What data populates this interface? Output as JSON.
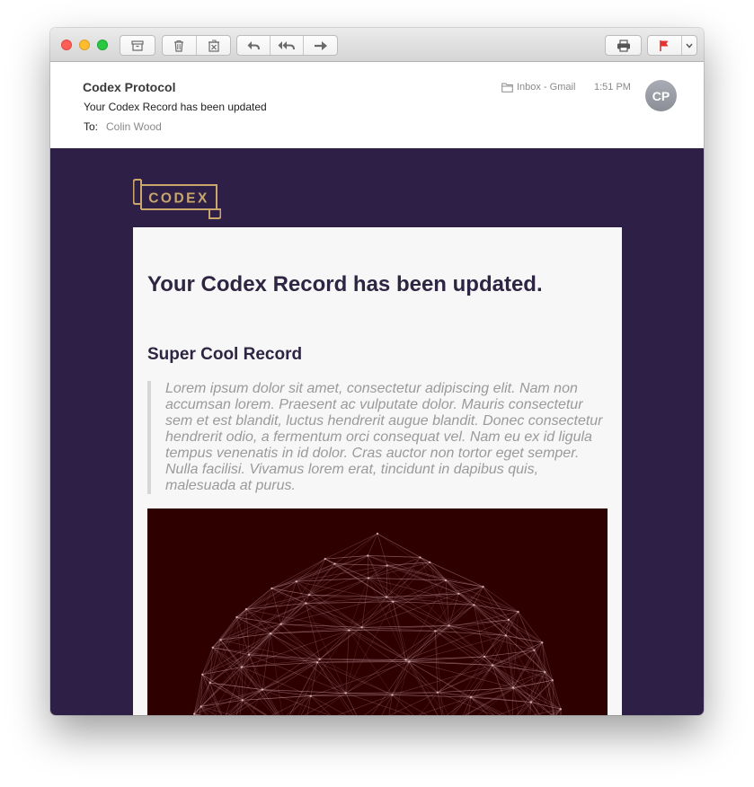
{
  "toolbar": {
    "buttons": [
      "archive",
      "delete",
      "junk",
      "reply",
      "reply-all",
      "forward",
      "print",
      "flag",
      "flag-menu"
    ]
  },
  "message": {
    "sender": "Codex Protocol",
    "subject": "Your Codex Record has been updated",
    "to_label": "To:",
    "to_value": "Colin Wood",
    "mailbox": "Inbox - Gmail",
    "time": "1:51 PM",
    "avatar_initials": "CP"
  },
  "email": {
    "logo_text": "CODEX",
    "title": "Your Codex Record has been updated.",
    "record_title": "Super Cool Record",
    "description": "Lorem ipsum dolor sit amet, consectetur adipiscing elit. Nam non accumsan lorem. Praesent ac vulputate dolor. Mauris consectetur sem et est blandit, luctus hendrerit augue blandit. Donec consectetur hendrerit odio, a fermentum orci consequat vel. Nam eu ex id ligula tempus venenatis in id dolor. Cras auctor non tortor eget semper. Nulla facilisi. Vivamus lorem erat, tincidunt in dapibus quis, malesuada at purus."
  },
  "colors": {
    "email_background": "#2e1f47",
    "card_background": "#f7f7f7",
    "heading": "#2e2542",
    "quote_text": "#9a9a9a",
    "logo_gold": "#c9a66b",
    "artwork_background": "#2f0000",
    "flag_red": "#e5322d",
    "traffic_red": "#fd5f57",
    "traffic_yellow": "#febc2e",
    "traffic_green": "#28c840"
  }
}
